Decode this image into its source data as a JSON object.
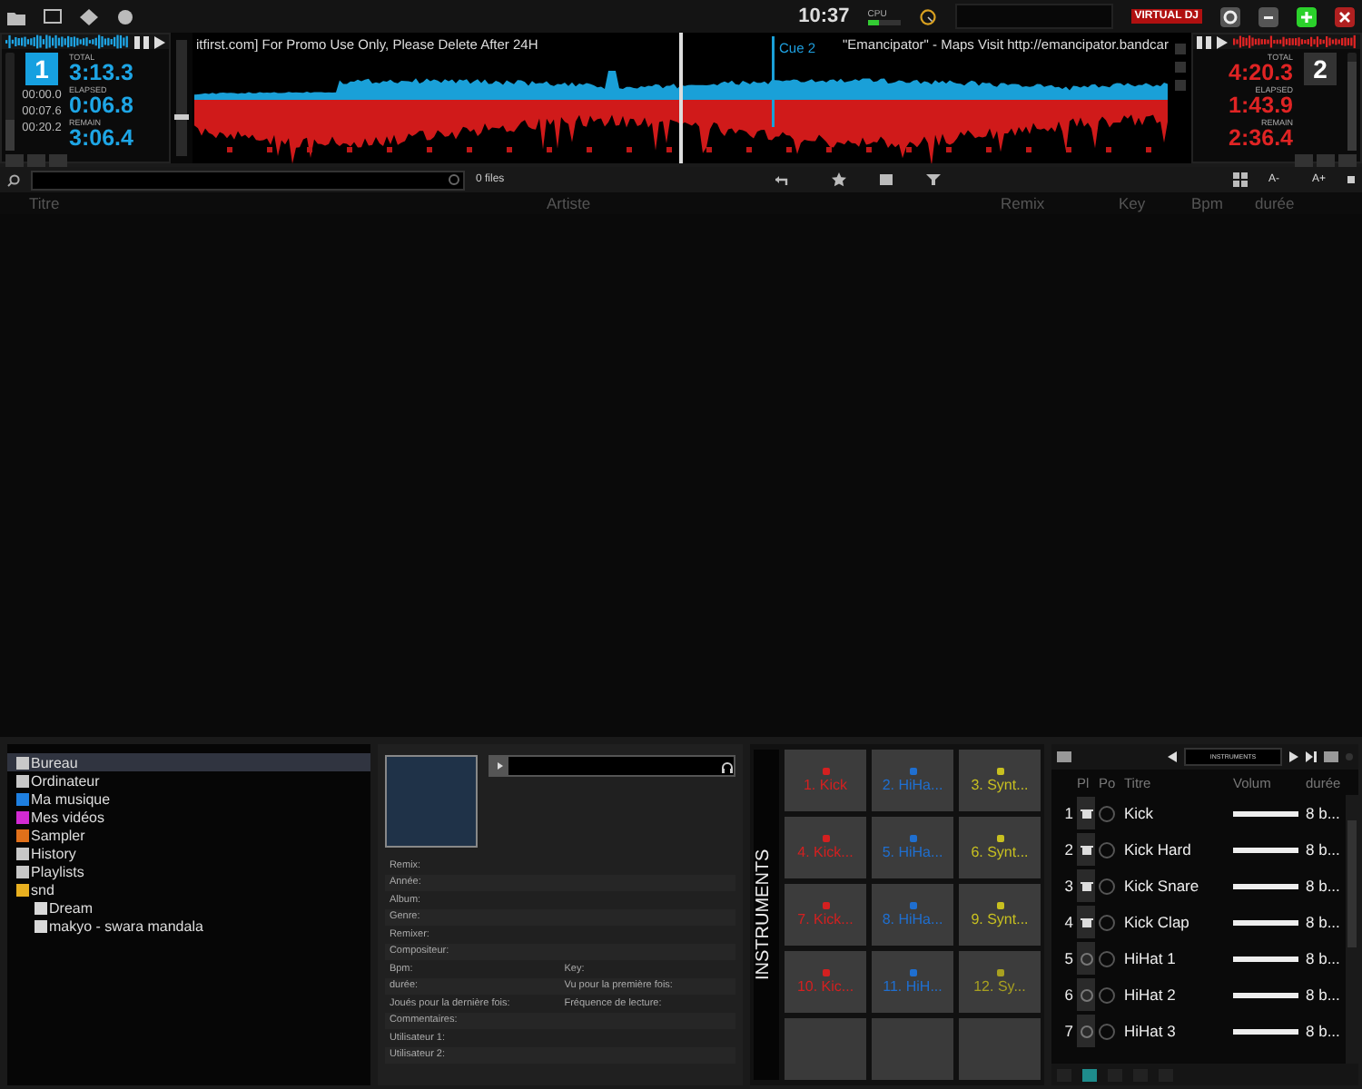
{
  "topbar": {
    "clock": "10:37",
    "cpu_label": "CPU",
    "logo": "VIRTUAL DJ"
  },
  "decks": [
    {
      "number": "1",
      "selected": true,
      "color": "#1ea6e6",
      "total_label": "TOTAL",
      "total": "3:13.3",
      "elapsed_label": "ELAPSED",
      "elapsed": "0:06.8",
      "remain_label": "REMAIN",
      "remain": "3:06.4",
      "cue_times": [
        "00:00.0",
        "00:07.6",
        "00:20.2"
      ],
      "pitch": {
        "level": 0.32
      }
    },
    {
      "number": "2",
      "selected": false,
      "color": "#e02424",
      "total_label": "TOTAL",
      "total": "4:20.3",
      "elapsed_label": "ELAPSED",
      "elapsed": "1:43.9",
      "remain_label": "REMAIN",
      "remain": "2:36.4",
      "pitch": {
        "level": 0.9
      }
    }
  ],
  "crossfader": {
    "level": 0.32
  },
  "waveform": {
    "title_left": "itfirst.com] For Promo Use Only, Please Delete After 24H",
    "cue_label": "Cue 2",
    "title_right": "\"Emancipator\" - Maps   Visit http://emancipator.bandcar"
  },
  "browser": {
    "file_count": "0 files",
    "font_buttons": [
      "A-",
      "A+"
    ],
    "columns": [
      "Titre",
      "Artiste",
      "Remix",
      "Key",
      "Bpm",
      "durée"
    ]
  },
  "folders": [
    {
      "label": "Bureau",
      "color": "#c8c8c8",
      "selected": true
    },
    {
      "label": "Ordinateur",
      "color": "#c8c8c8",
      "selected": false
    },
    {
      "label": "Ma musique",
      "color": "#1e7fe0",
      "selected": false
    },
    {
      "label": "Mes vidéos",
      "color": "#d22ad2",
      "selected": false
    },
    {
      "label": "Sampler",
      "color": "#e0701a",
      "selected": false
    },
    {
      "label": "History",
      "color": "#c8c8c8",
      "selected": false
    },
    {
      "label": "Playlists",
      "color": "#c8c8c8",
      "selected": false
    },
    {
      "label": "snd",
      "color": "#e8b020",
      "selected": false,
      "children": [
        {
          "label": "Dream",
          "color": "#d8d8d8",
          "selected": false
        },
        {
          "label": "makyo - swara mandala",
          "color": "#d8d8d8",
          "selected": false
        }
      ]
    }
  ],
  "info": {
    "fields": [
      [
        "Remix:"
      ],
      [
        "Année:"
      ],
      [
        "Album:"
      ],
      [
        "Genre:"
      ],
      [
        "Remixer:"
      ],
      [
        "Compositeur:"
      ],
      [
        "Bpm:",
        "Key:"
      ],
      [
        "durée:",
        "Vu pour la première fois:"
      ],
      [
        "Joués pour la dernière fois:",
        "Fréquence de lecture:"
      ],
      [
        "Commentaires:"
      ],
      [
        "Utilisateur 1:"
      ],
      [
        "Utilisateur 2:"
      ]
    ]
  },
  "pads": {
    "title": "INSTRUMENTS",
    "items": [
      {
        "kind": "sample",
        "label": "1. Kick",
        "color": "#d42020"
      },
      {
        "kind": "sample",
        "label": "2. HiHa...",
        "color": "#1f6fd0"
      },
      {
        "kind": "sample",
        "label": "3. Synt...",
        "color": "#c8c020"
      },
      {
        "kind": "sample",
        "label": "4. Kick...",
        "color": "#d42020"
      },
      {
        "kind": "sample",
        "label": "5. HiHa...",
        "color": "#1f6fd0"
      },
      {
        "kind": "sample",
        "label": "6. Synt...",
        "color": "#c8c020"
      },
      {
        "kind": "sample",
        "label": "7. Kick...",
        "color": "#d42020"
      },
      {
        "kind": "sample",
        "label": "8. HiHa...",
        "color": "#1f6fd0"
      },
      {
        "kind": "sample",
        "label": "9. Synt...",
        "color": "#c8c020"
      },
      {
        "kind": "sample",
        "label": "10. Kic...",
        "color": "#d42020"
      },
      {
        "kind": "sample",
        "label": "11. HiH...",
        "color": "#1f6fd0"
      },
      {
        "kind": "sample",
        "label": "12. Sy...",
        "color": "#a8a020"
      },
      {
        "kind": "empty"
      },
      {
        "kind": "empty"
      },
      {
        "kind": "empty"
      }
    ]
  },
  "sampler": {
    "bank": "INSTRUMENTS",
    "columns": [
      "Pl",
      "Po",
      "Titre",
      "Volum",
      "durée"
    ],
    "rows": [
      {
        "number": "1",
        "kind": "drum",
        "title": "Kick",
        "level": 1,
        "duration": "8 b..."
      },
      {
        "number": "2",
        "kind": "drum",
        "title": "Kick Hard",
        "level": 1,
        "duration": "8 b..."
      },
      {
        "number": "3",
        "kind": "drum",
        "title": "Kick Snare",
        "level": 1,
        "duration": "8 b..."
      },
      {
        "number": "4",
        "kind": "drum",
        "title": "Kick Clap",
        "level": 1,
        "duration": "8 b..."
      },
      {
        "number": "5",
        "kind": "hihat",
        "title": "HiHat 1",
        "level": 1,
        "duration": "8 b..."
      },
      {
        "number": "6",
        "kind": "hihat",
        "title": "HiHat 2",
        "level": 1,
        "duration": "8 b..."
      },
      {
        "number": "7",
        "kind": "hihat",
        "title": "HiHat 3",
        "level": 1,
        "duration": "8 b..."
      }
    ],
    "view_buttons": [
      {
        "selected": false
      },
      {
        "selected": true
      },
      {
        "selected": false
      },
      {
        "selected": false
      },
      {
        "selected": false
      }
    ]
  }
}
